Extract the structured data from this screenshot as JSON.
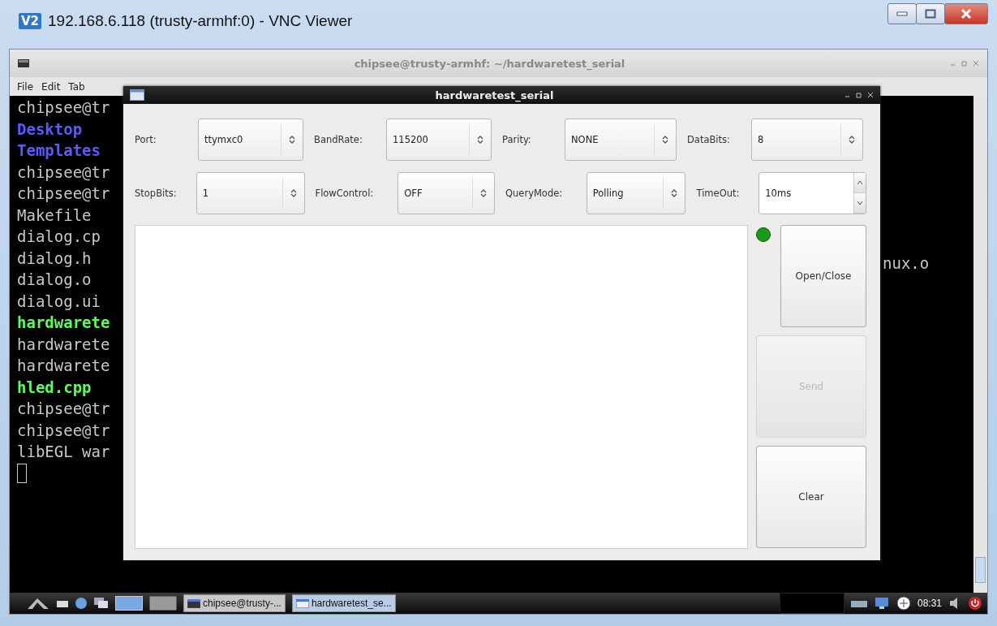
{
  "viewer": {
    "logo_text": "V2",
    "title": "192.168.6.118 (trusty-armhf:0) - VNC Viewer"
  },
  "terminal": {
    "title": "chipsee@trusty-armhf: ~/hardwaretest_serial",
    "menu": [
      "File",
      "Edit",
      "Tab"
    ],
    "lines": [
      {
        "text": "chipsee@tr",
        "color": "#c8c8c8",
        "bold": false
      },
      {
        "text": "Desktop",
        "color": "#5a5aff",
        "bold": true
      },
      {
        "text": "Templates",
        "color": "#5a5aff",
        "bold": true
      },
      {
        "text": "chipsee@tr",
        "color": "#c8c8c8",
        "bold": false
      },
      {
        "text": "chipsee@tr",
        "color": "#c8c8c8",
        "bold": false
      },
      {
        "text": "Makefile",
        "color": "#c8c8c8",
        "bold": false
      },
      {
        "text": "dialog.cp",
        "color": "#c8c8c8",
        "bold": false
      },
      {
        "text": "dialog.h",
        "color": "#c8c8c8",
        "bold": false
      },
      {
        "text": "dialog.o",
        "color": "#c8c8c8",
        "bold": false
      },
      {
        "text": "dialog.ui",
        "color": "#c8c8c8",
        "bold": false
      },
      {
        "text": "hardwarete",
        "color": "#5aff5a",
        "bold": true
      },
      {
        "text": "hardwarete",
        "color": "#c8c8c8",
        "bold": false
      },
      {
        "text": "hardwarete",
        "color": "#c8c8c8",
        "bold": false
      },
      {
        "text": "hled.cpp",
        "color": "#5aff5a",
        "bold": true
      },
      {
        "text": "chipsee@tr",
        "color": "#c8c8c8",
        "bold": false
      },
      {
        "text": "chipsee@tr",
        "color": "#c8c8c8",
        "bold": false
      },
      {
        "text": "libEGL war",
        "color": "#c8c8c8",
        "bold": false
      }
    ],
    "right_text": "nux.o"
  },
  "dialog": {
    "title": "hardwaretest_serial",
    "settings": [
      [
        {
          "label": "Port:",
          "value": "ttymxc0",
          "kind": "combo"
        },
        {
          "label": "BandRate:",
          "value": "115200",
          "kind": "combo"
        },
        {
          "label": "Parity:",
          "value": "NONE",
          "kind": "combo"
        },
        {
          "label": "DataBits:",
          "value": "8",
          "kind": "combo"
        }
      ],
      [
        {
          "label": "StopBits:",
          "value": "1",
          "kind": "combo"
        },
        {
          "label": "FlowControl:",
          "value": "OFF",
          "kind": "combo"
        },
        {
          "label": "QueryMode:",
          "value": "Polling",
          "kind": "combo"
        },
        {
          "label": "TimeOut:",
          "value": "10ms",
          "kind": "spin"
        }
      ]
    ],
    "led": {
      "on": true
    },
    "buttons": [
      {
        "label": "Open/Close",
        "disabled": false
      },
      {
        "label": "Send",
        "disabled": true
      },
      {
        "label": "Clear",
        "disabled": false
      }
    ]
  },
  "taskbar": {
    "tasks": [
      {
        "label": "chipsee@trusty-...",
        "selected": false
      },
      {
        "label": "hardwaretest_se...",
        "selected": true
      }
    ],
    "clock": "08:31"
  }
}
